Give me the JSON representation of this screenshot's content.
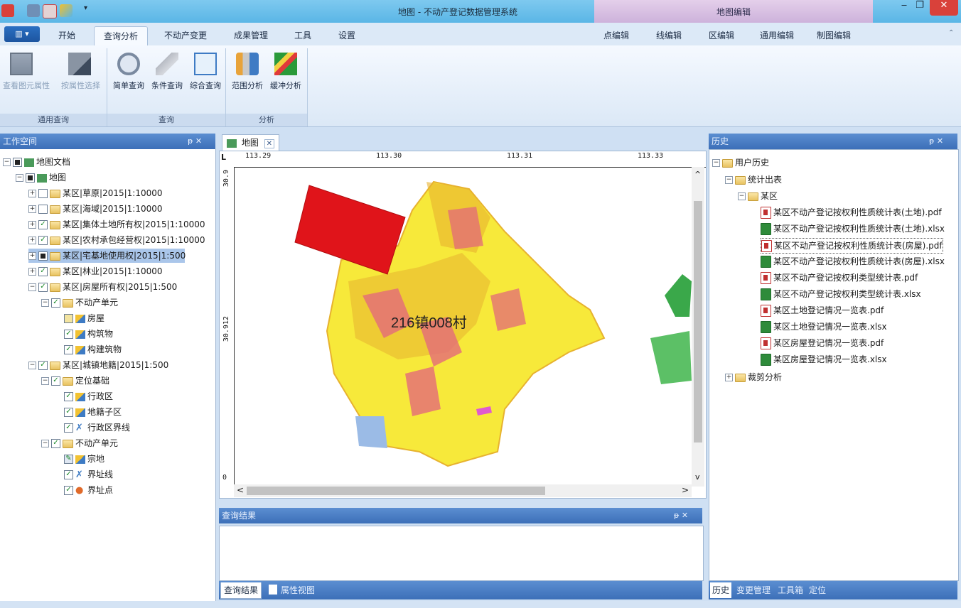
{
  "window": {
    "title": "地图 - 不动产登记数据管理系统",
    "context_tab_group": "地图编辑",
    "close_glyph": "✕",
    "minimize_glyph": "‒",
    "restore_glyph": "❐"
  },
  "menu": {
    "app_button": "▥ ▾",
    "tabs": [
      "开始",
      "查询分析",
      "不动产变更",
      "成果管理",
      "工具",
      "设置"
    ],
    "active_tab": "查询分析",
    "context_tabs": [
      "点编辑",
      "线编辑",
      "区编辑",
      "通用编辑",
      "制图编辑"
    ]
  },
  "ribbon": {
    "groups": [
      {
        "label": "通用查询",
        "buttons": [
          "查看图元属性",
          "按属性选择"
        ]
      },
      {
        "label": "查询",
        "buttons": [
          "简单查询",
          "条件查询",
          "综合查询"
        ]
      },
      {
        "label": "分析",
        "buttons": [
          "范围分析",
          "缓冲分析"
        ]
      }
    ]
  },
  "workspace": {
    "title": "工作空间",
    "pin": "ᵽ ✕",
    "tree": [
      {
        "label": "地图文档",
        "level": 0
      },
      {
        "label": "地图",
        "level": 1
      },
      {
        "label": "某区|草原|2015|1:10000",
        "level": 2
      },
      {
        "label": "某区|海域|2015|1:10000",
        "level": 2
      },
      {
        "label": "某区|集体土地所有权|2015|1:10000",
        "level": 2
      },
      {
        "label": "某区|农村承包经营权|2015|1:10000",
        "level": 2
      },
      {
        "label": "某区|宅基地使用权|2015|1:500",
        "level": 2
      },
      {
        "label": "某区|林业|2015|1:10000",
        "level": 2
      },
      {
        "label": "某区|房屋所有权|2015|1:500",
        "level": 2
      },
      {
        "label": "不动产单元",
        "level": 3
      },
      {
        "label": "房屋",
        "level": 4
      },
      {
        "label": "构筑物",
        "level": 4
      },
      {
        "label": "构建筑物",
        "level": 4
      },
      {
        "label": "某区|城镇地籍|2015|1:500",
        "level": 2
      },
      {
        "label": "定位基础",
        "level": 3
      },
      {
        "label": "行政区",
        "level": 4
      },
      {
        "label": "地籍子区",
        "level": 4
      },
      {
        "label": "行政区界线",
        "level": 4
      },
      {
        "label": "不动产单元",
        "level": 3
      },
      {
        "label": "宗地",
        "level": 4
      },
      {
        "label": "界址线",
        "level": 4
      },
      {
        "label": "界址点",
        "level": 4
      }
    ]
  },
  "map": {
    "tab_label": "地图",
    "tab_close": "✕",
    "x_ticks": [
      "113.29",
      "113.30",
      "113.31",
      "113.33"
    ],
    "y_ticks": [
      "30.9",
      "30.912",
      "0"
    ],
    "ruler_corner": "L",
    "label": "216镇008村",
    "scroll_up": "^",
    "scroll_down": "v",
    "scroll_left": "<",
    "scroll_right": ">",
    "colors": {
      "yellow": "#f7e93a",
      "orange": "#e7b22f",
      "pink": "#e36a7a",
      "red": "#e0141a",
      "green": "#3aa84a",
      "lightblue": "#9bbbe6"
    }
  },
  "results": {
    "title": "查询结果",
    "pin": "ᵽ ✕",
    "tabs": [
      "查询结果",
      "属性视图"
    ]
  },
  "history": {
    "title": "历史",
    "pin": "ᵽ ✕",
    "root": "用户历史",
    "folder1": "统计出表",
    "subfolder": "某区",
    "files": [
      {
        "name": "某区不动产登记按权利性质统计表(土地).pdf",
        "type": "pdf"
      },
      {
        "name": "某区不动产登记按权利性质统计表(土地).xlsx",
        "type": "xls"
      },
      {
        "name": "某区不动产登记按权利性质统计表(房屋).pdf",
        "type": "pdf"
      },
      {
        "name": "某区不动产登记按权利性质统计表(房屋).xlsx",
        "type": "xls"
      },
      {
        "name": "某区不动产登记按权利类型统计表.pdf",
        "type": "pdf"
      },
      {
        "name": "某区不动产登记按权利类型统计表.xlsx",
        "type": "xls"
      },
      {
        "name": "某区土地登记情况一览表.pdf",
        "type": "pdf"
      },
      {
        "name": "某区土地登记情况一览表.xlsx",
        "type": "xls"
      },
      {
        "name": "某区房屋登记情况一览表.pdf",
        "type": "pdf"
      },
      {
        "name": "某区房屋登记情况一览表.xlsx",
        "type": "xls"
      }
    ],
    "folder2": "裁剪分析",
    "tabs": [
      "历史",
      "变更管理",
      "工具箱",
      "定位"
    ]
  }
}
